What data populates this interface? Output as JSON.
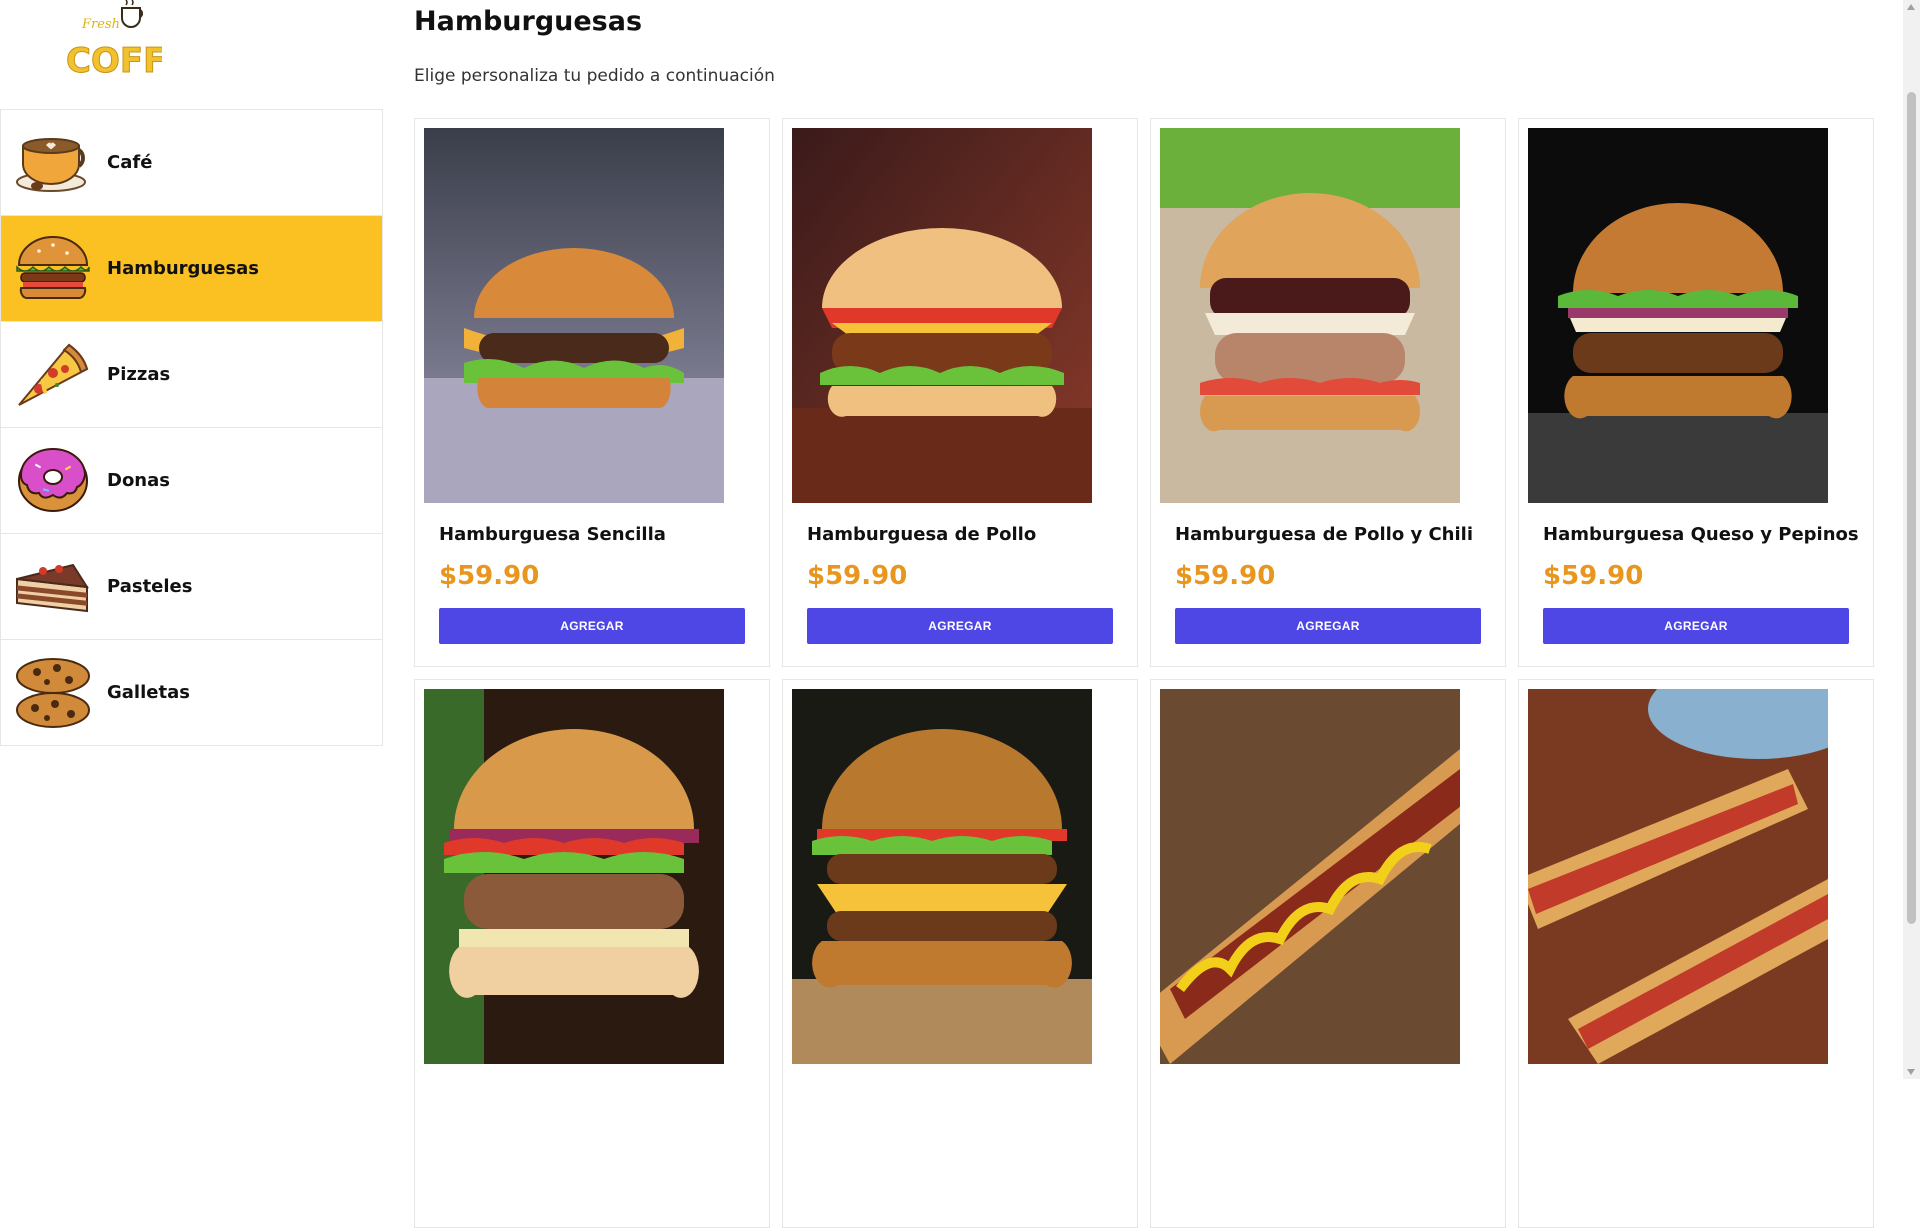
{
  "brand": {
    "logo_text": "COFFEE",
    "logo_script": "Fresh"
  },
  "sidebar": {
    "items": [
      {
        "label": "Café",
        "icon": "coffee-cup-icon",
        "active": false
      },
      {
        "label": "Hamburguesas",
        "icon": "burger-icon",
        "active": true
      },
      {
        "label": "Pizzas",
        "icon": "pizza-slice-icon",
        "active": false
      },
      {
        "label": "Donas",
        "icon": "donut-icon",
        "active": false
      },
      {
        "label": "Pasteles",
        "icon": "cake-slice-icon",
        "active": false
      },
      {
        "label": "Galletas",
        "icon": "cookies-icon",
        "active": false
      }
    ]
  },
  "main": {
    "title": "Hamburguesas",
    "subtitle": "Elige personaliza tu pedido a continuación",
    "products": [
      {
        "name": "Hamburguesa Sencilla",
        "price": "$59.90",
        "button": "AGREGAR",
        "image": "burger-photo"
      },
      {
        "name": "Hamburguesa de Pollo",
        "price": "$59.90",
        "button": "AGREGAR",
        "image": "chicken-burger-photo"
      },
      {
        "name": "Hamburguesa de Pollo y Chili",
        "price": "$59.90",
        "button": "AGREGAR",
        "image": "chili-chicken-burger-photo"
      },
      {
        "name": "Hamburguesa Queso y Pepinos",
        "price": "$59.90",
        "button": "AGREGAR",
        "image": "cheese-pickle-burger-photo"
      },
      {
        "name": "",
        "price": "",
        "button": "",
        "image": "burger-photo"
      },
      {
        "name": "",
        "price": "",
        "button": "",
        "image": "cheeseburger-photo"
      },
      {
        "name": "",
        "price": "",
        "button": "",
        "image": "hotdog-photo"
      },
      {
        "name": "",
        "price": "",
        "button": "",
        "image": "hotdogs-photo"
      }
    ]
  },
  "colors": {
    "accent": "#fbc123",
    "button": "#4e46e5",
    "price": "#e8961e"
  }
}
